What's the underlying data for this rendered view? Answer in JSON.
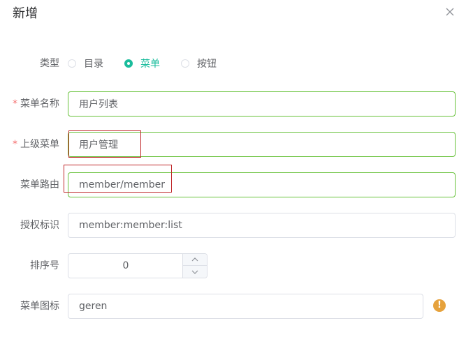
{
  "dialog": {
    "title": "新增"
  },
  "form": {
    "type_label": "类型",
    "type_options": [
      "目录",
      "菜单",
      "按钮"
    ],
    "type_selected": "菜单",
    "name_label": "菜单名称",
    "name_value": "用户列表",
    "parent_label": "上级菜单",
    "parent_value": "用户管理",
    "route_label": "菜单路由",
    "route_value": "member/member",
    "perm_label": "授权标识",
    "perm_value": "member:member:list",
    "order_label": "排序号",
    "order_value": "0",
    "icon_label": "菜单图标",
    "icon_value": "geren",
    "required_mark": "*"
  },
  "icons": {
    "close": "close-icon",
    "warning": "warning-circle-icon",
    "chevron_up": "chevron-up-icon",
    "chevron_down": "chevron-down-icon"
  },
  "colors": {
    "accent": "#1abc9c",
    "valid_border": "#67c23a",
    "required": "#f56c6c",
    "annotation": "#c0282a",
    "warning": "#e6a23c"
  }
}
